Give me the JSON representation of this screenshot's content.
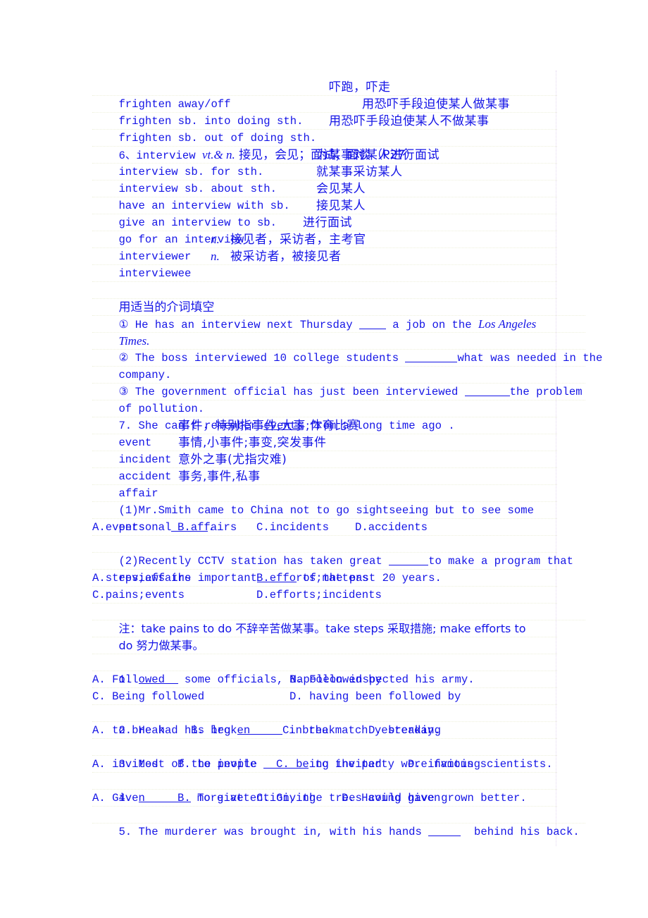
{
  "vocab_frighten": [
    {
      "en": "frighten away/off",
      "cn": "吓跑，吓走"
    },
    {
      "en": "frighten sb. into doing sth.",
      "cn": "用恐吓手段迫使某人做某事"
    },
    {
      "en": "frighten sb. out of doing sth.",
      "cn": "用恐吓手段迫使某人不做某事"
    }
  ],
  "interview_heading": {
    "num": "6、interview ",
    "pos": "vt.& n.",
    "cn": " 接见，会见；面试；面谈（P27）"
  },
  "vocab_interview": [
    {
      "en": "interview sb. for sth.",
      "cn": "为某事对某人进行面试"
    },
    {
      "en": "interview sb. about sth.",
      "cn": "就某事采访某人"
    },
    {
      "en": "have an interview with sb.",
      "cn": "会见某人"
    },
    {
      "en": "give an interview to sb.",
      "cn": "接见某人"
    },
    {
      "en": "go for an interview",
      "cn": "进行面试"
    },
    {
      "en": "interviewer",
      "pos": "n.",
      "cn": "接见者，采访者，主考官"
    },
    {
      "en": "interviewee",
      "pos": "n.",
      "cn": "被采访者，被接见者"
    }
  ],
  "prep_exercise": {
    "title": "用适当的介词填空",
    "q1_a": "① He has an interview next Thursday ",
    "q1_b": " a job on the ",
    "q1_italic": "Los Angeles",
    "q1_c": "Times.",
    "q2_a": "② The boss interviewed 10 college students ",
    "q2_b": "what was needed in the",
    "q2_c": "company.",
    "q3_a": "③ The government official has just been interviewed ",
    "q3_b": "the problem",
    "q3_c": "of pollution."
  },
  "events_section": {
    "sentence_a": "7. She can’t remember ",
    "sentence_ul": "events",
    "sentence_b": " from a long time ago .",
    "words": [
      {
        "en": "event",
        "cn": "事件，特别指事件,大事;体育比赛"
      },
      {
        "en": "incident",
        "cn": "事情,小事件;事变,突发事件"
      },
      {
        "en": "accident",
        "cn": "意外之事(尤指灾难)"
      },
      {
        "en": "affair",
        "cn": "事务,事件,私事"
      }
    ],
    "q1_line1": "(1)Mr.Smith came to China not to go sightseeing but to see some",
    "q1_line2": "personal",
    "q1_line2_end": ".",
    "q1_options": [
      "A.events",
      "B.affairs",
      "C.incidents",
      "D.accidents"
    ],
    "q2_line1_a": "(2)Recently CCTV station has taken great ",
    "q2_line1_b": "to make a program that",
    "q2_line2_a": "reviews the important",
    "q2_line2_b": " of the past 20 years.",
    "q2_options": [
      "A.steps;affairs",
      "B.efforts;matters",
      "C.pains;events",
      "D.efforts;incidents"
    ],
    "note_line1": "注：take pains to do 不辞辛苦做某事。take steps 采取措施; make efforts to",
    "note_line2": "do 努力做某事。"
  },
  "mc_questions": [
    {
      "num": "1. ",
      "stem_after": " some officials, Napoleon inspected his army.",
      "options": [
        "A. Followed",
        "B. Followed by",
        "C. Being followed",
        "D. having been followed by"
      ]
    },
    {
      "num": "2. ",
      "stem_before": "He had his leg ",
      "stem_after": " in the match yesterday.",
      "options": [
        "A. to break",
        "B. broken",
        "C. break",
        "D. breaking"
      ]
    },
    {
      "num": "3. ",
      "stem_before": "Most of the people ",
      "stem_after": " to the party were famous scientists.",
      "options": [
        "A. invited",
        "B. to invite",
        "C. being invited",
        "D. inviting"
      ]
    },
    {
      "num": "4. ",
      "stem_after": " more attention, the trees could have grown better.",
      "options": [
        "A. Given",
        "B. To give",
        "C. Giving",
        "D. Having given"
      ]
    },
    {
      "num": "5. ",
      "stem_before": "The murderer was brought in, with his hands ",
      "stem_after": "  behind his back."
    }
  ]
}
